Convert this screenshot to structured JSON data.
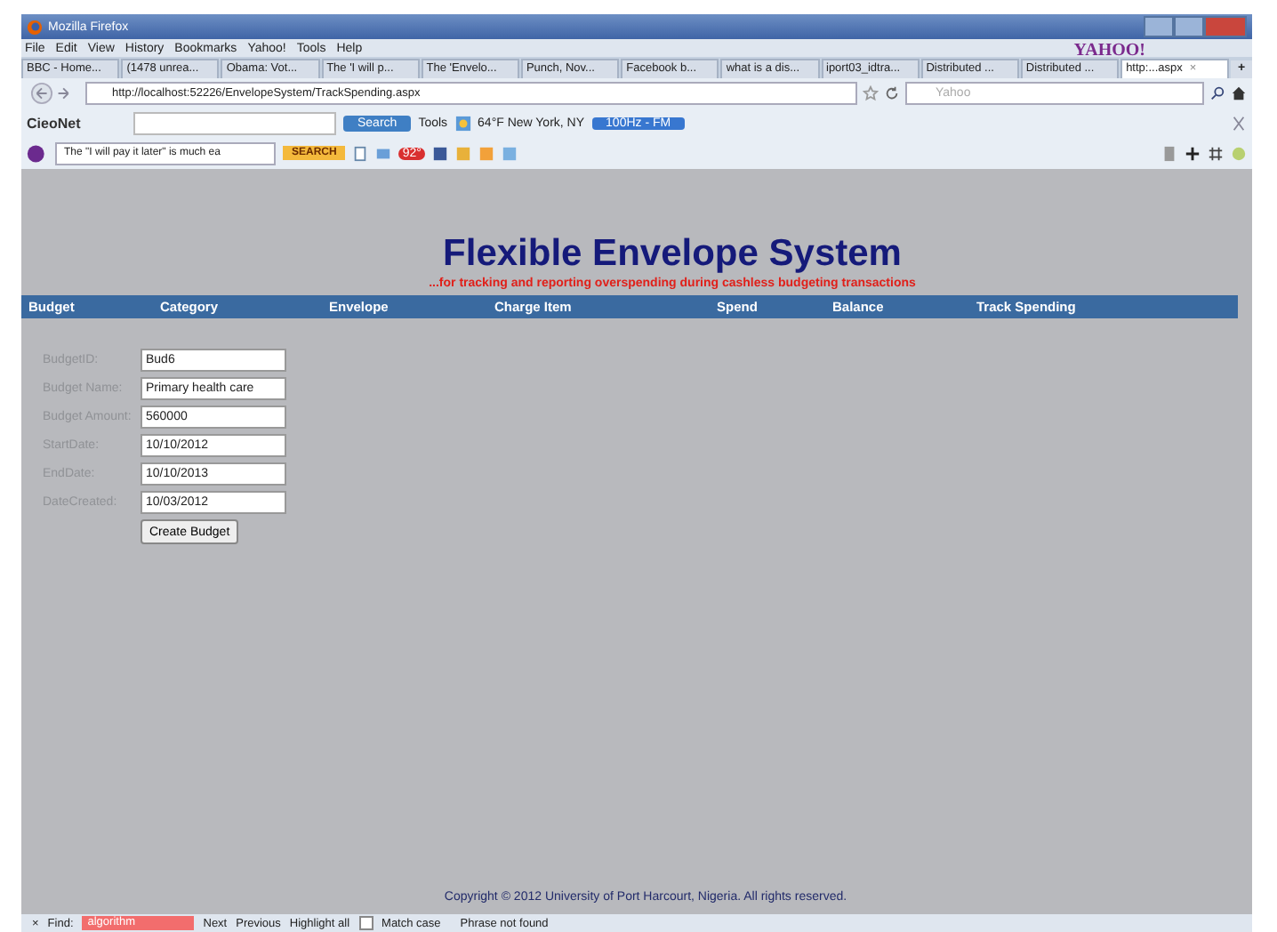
{
  "window": {
    "title": "Mozilla Firefox"
  },
  "menu": [
    "File",
    "Edit",
    "View",
    "History",
    "Bookmarks",
    "Yahoo!",
    "Tools",
    "Help"
  ],
  "tabs": [
    {
      "label": "BBC - Home...",
      "selected": false
    },
    {
      "label": "(1478 unrea...",
      "selected": false
    },
    {
      "label": "Obama: Vot...",
      "selected": false
    },
    {
      "label": "The 'I will p...",
      "selected": false
    },
    {
      "label": "The 'Envelo...",
      "selected": false
    },
    {
      "label": "Punch, Nov...",
      "selected": false
    },
    {
      "label": "Facebook b...",
      "selected": false
    },
    {
      "label": "what is a dis...",
      "selected": false
    },
    {
      "label": "iport03_idtra...",
      "selected": false
    },
    {
      "label": "Distributed ...",
      "selected": false
    },
    {
      "label": "Distributed ...",
      "selected": false
    },
    {
      "label": "http:...aspx",
      "selected": true
    }
  ],
  "tab_close": "×",
  "new_tab": "+",
  "yahoo_logo": "YAHOO!",
  "address_bar": {
    "url": "http://localhost:52226/EnvelopeSystem/TrackSpending.aspx",
    "search_placeholder": "Yahoo"
  },
  "toolbar_1": {
    "brand": "CieoNet",
    "search_button": "Search",
    "tools": "Tools",
    "weather": "64°F New York, NY",
    "radio": "100Hz - FM"
  },
  "toolbar_2": {
    "search_value": "The \"I will pay it later\" is much ea",
    "search_button": "SEARCH",
    "badge": "92°"
  },
  "page": {
    "title": "Flexible Envelope System",
    "subtitle": "...for tracking and reporting overspending during cashless budgeting transactions",
    "nav": [
      "Budget",
      "Category",
      "Envelope",
      "Charge Item",
      "Spend",
      "Balance",
      "Track Spending"
    ],
    "form": [
      {
        "label": "BudgetID:",
        "value": "Bud6"
      },
      {
        "label": "Budget Name:",
        "value": "Primary health care"
      },
      {
        "label": "Budget Amount:",
        "value": "560000"
      },
      {
        "label": "StartDate:",
        "value": "10/10/2012"
      },
      {
        "label": "EndDate:",
        "value": "10/10/2013"
      },
      {
        "label": "DateCreated:",
        "value": "10/03/2012"
      }
    ],
    "button": "Create Budget",
    "footer": "Copyright © 2012 University of Port Harcourt, Nigeria. All rights reserved."
  },
  "find_bar": {
    "close": "×",
    "label": "Find:",
    "value": "algorithm",
    "not_found": true,
    "next": "Next",
    "previous": "Previous",
    "highlight": "Highlight all",
    "match_case": {
      "label": "Match case",
      "checked": false
    },
    "status": "Phrase not found"
  }
}
